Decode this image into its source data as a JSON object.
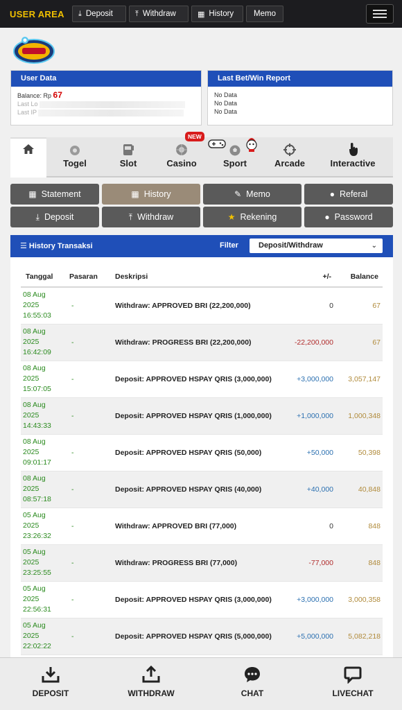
{
  "topbar": {
    "brand": "USER AREA",
    "buttons": [
      {
        "label": "Deposit",
        "icon": "deposit-icon"
      },
      {
        "label": "Withdraw",
        "icon": "withdraw-icon"
      },
      {
        "label": "History",
        "icon": "calendar-icon"
      },
      {
        "label": "Memo",
        "icon": ""
      }
    ]
  },
  "user_data": {
    "title": "User Data",
    "balance_label": "Balance: Rp",
    "balance_value": "67",
    "last_login_label": "Last Lo",
    "last_ip_label": "Last IP"
  },
  "report": {
    "title": "Last Bet/Win Report",
    "lines": [
      "No Data",
      "No Data",
      "No Data"
    ]
  },
  "game_tabs": [
    {
      "label": "",
      "icon": "home-icon"
    },
    {
      "label": "Togel",
      "icon": "ball-icon"
    },
    {
      "label": "Slot",
      "icon": "slot-machine-icon"
    },
    {
      "label": "Casino",
      "icon": "roulette-icon"
    },
    {
      "label": "Sport",
      "icon": "soccer-ball-icon"
    },
    {
      "label": "Arcade",
      "icon": "crosshair-icon"
    },
    {
      "label": "Interactive",
      "icon": "tap-hand-icon"
    }
  ],
  "new_badge": "NEW",
  "actions": {
    "row1": [
      {
        "label": "Statement",
        "icon": "calendar-icon"
      },
      {
        "label": "History",
        "icon": "calendar-icon"
      },
      {
        "label": "Memo",
        "icon": "edit-icon"
      },
      {
        "label": "Referal",
        "icon": "user-icon"
      }
    ],
    "row2": [
      {
        "label": "Deposit",
        "icon": "deposit-icon"
      },
      {
        "label": "Withdraw",
        "icon": "withdraw-icon"
      },
      {
        "label": "Rekening",
        "icon": "bank-icon"
      },
      {
        "label": "Password",
        "icon": "user-icon"
      }
    ]
  },
  "history": {
    "title": "History Transaksi",
    "filter_label": "Filter",
    "filter_value": "Deposit/Withdraw",
    "columns": [
      "Tanggal",
      "Pasaran",
      "Deskripsi",
      "+/-",
      "Balance"
    ],
    "rows": [
      {
        "date": "08 Aug",
        "year": "2025",
        "time": "16:55:03",
        "pasaran": "-",
        "desc": "Withdraw: APPROVED BRI (22,200,000)",
        "amount": "0",
        "kind": "zero",
        "balance": "67"
      },
      {
        "date": "08 Aug",
        "year": "2025",
        "time": "16:42:09",
        "pasaran": "-",
        "desc": "Withdraw: PROGRESS BRI (22,200,000)",
        "amount": "-22,200,000",
        "kind": "neg",
        "balance": "67"
      },
      {
        "date": "08 Aug",
        "year": "2025",
        "time": "15:07:05",
        "pasaran": "-",
        "desc": "Deposit: APPROVED HSPAY QRIS (3,000,000)",
        "amount": "+3,000,000",
        "kind": "pos",
        "balance": "3,057,147"
      },
      {
        "date": "08 Aug",
        "year": "2025",
        "time": "14:43:33",
        "pasaran": "-",
        "desc": "Deposit: APPROVED HSPAY QRIS (1,000,000)",
        "amount": "+1,000,000",
        "kind": "pos",
        "balance": "1,000,348"
      },
      {
        "date": "08 Aug",
        "year": "2025",
        "time": "09:01:17",
        "pasaran": "-",
        "desc": "Deposit: APPROVED HSPAY QRIS (50,000)",
        "amount": "+50,000",
        "kind": "pos",
        "balance": "50,398"
      },
      {
        "date": "08 Aug",
        "year": "2025",
        "time": "08:57:18",
        "pasaran": "-",
        "desc": "Deposit: APPROVED HSPAY QRIS (40,000)",
        "amount": "+40,000",
        "kind": "pos",
        "balance": "40,848"
      },
      {
        "date": "05 Aug",
        "year": "2025",
        "time": "23:26:32",
        "pasaran": "-",
        "desc": "Withdraw: APPROVED BRI (77,000)",
        "amount": "0",
        "kind": "zero",
        "balance": "848"
      },
      {
        "date": "05 Aug",
        "year": "2025",
        "time": "23:25:55",
        "pasaran": "-",
        "desc": "Withdraw: PROGRESS BRI (77,000)",
        "amount": "-77,000",
        "kind": "neg",
        "balance": "848"
      },
      {
        "date": "05 Aug",
        "year": "2025",
        "time": "22:56:31",
        "pasaran": "-",
        "desc": "Deposit: APPROVED HSPAY QRIS (3,000,000)",
        "amount": "+3,000,000",
        "kind": "pos",
        "balance": "3,000,358"
      },
      {
        "date": "05 Aug",
        "year": "2025",
        "time": "22:02:22",
        "pasaran": "-",
        "desc": "Deposit: APPROVED HSPAY QRIS (5,000,000)",
        "amount": "+5,000,000",
        "kind": "pos",
        "balance": "5,082,218"
      }
    ]
  },
  "bottom_nav": [
    {
      "label": "DEPOSIT",
      "icon": "download-tray-icon"
    },
    {
      "label": "WITHDRAW",
      "icon": "upload-tray-icon"
    },
    {
      "label": "CHAT",
      "icon": "chat-bubble-icon"
    },
    {
      "label": "LIVECHAT",
      "icon": "livechat-bubble-icon"
    }
  ]
}
